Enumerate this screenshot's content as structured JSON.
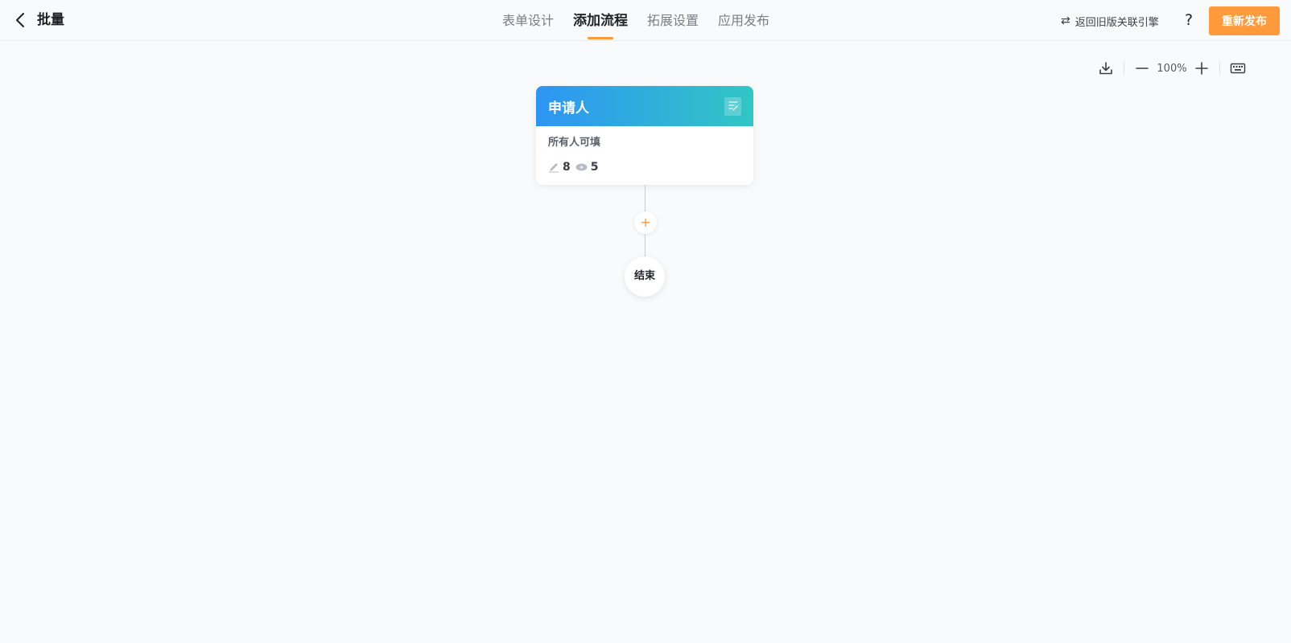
{
  "header": {
    "back_icon": "chevron-left-icon",
    "title": "批量",
    "tabs": [
      {
        "label": "表单设计",
        "active": false
      },
      {
        "label": "添加流程",
        "active": true
      },
      {
        "label": "拓展设置",
        "active": false
      },
      {
        "label": "应用发布",
        "active": false
      }
    ],
    "legacy_link": {
      "icon": "swap-arrows-icon",
      "label": "返回旧版关联引擎"
    },
    "help_label": "?",
    "publish_label": "重新发布"
  },
  "toolbar": {
    "zoom_level": "100%",
    "icons": [
      "download-icon",
      "zoom-out-icon",
      "zoom-in-icon",
      "keyboard-icon"
    ]
  },
  "flow": {
    "start_node": {
      "title": "申请人",
      "description": "所有人可填",
      "edit_count": "8",
      "view_count": "5"
    },
    "add_button_label": "+",
    "end_node": {
      "label": "结束"
    }
  },
  "colors": {
    "accent": "#ff9a3c",
    "node_gradient_start": "#2d95f3",
    "node_gradient_end": "#31c6c4",
    "background": "#f9fafc"
  }
}
